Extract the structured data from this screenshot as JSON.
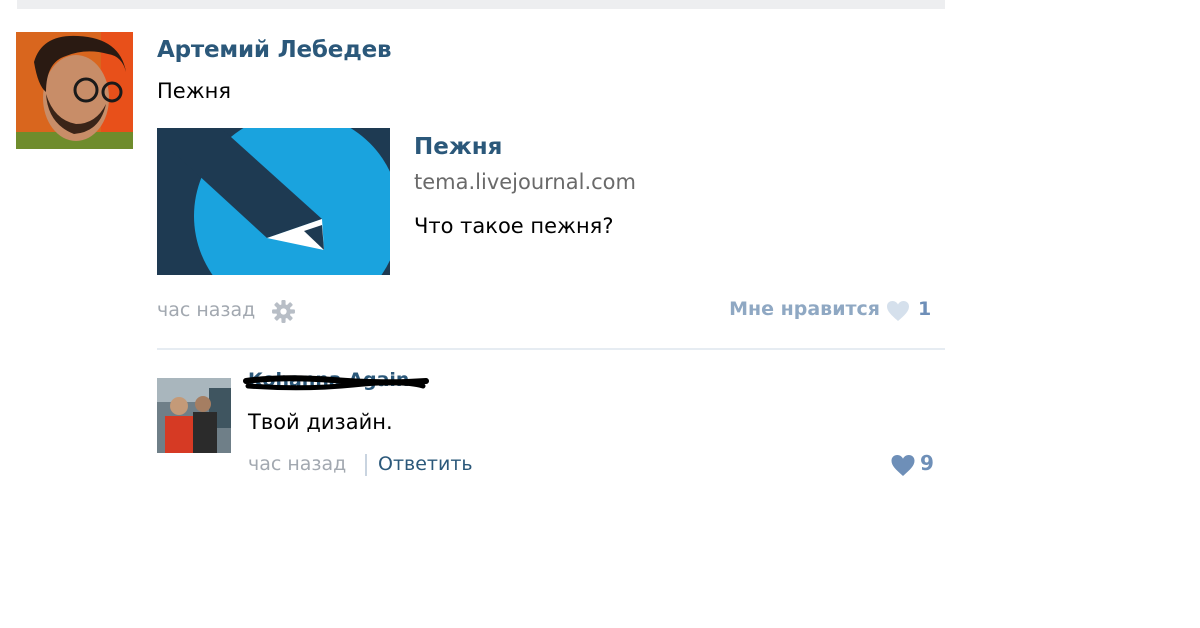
{
  "post": {
    "author": "Артемий Лебедев",
    "text": "Пежня",
    "link": {
      "title": "Пежня",
      "domain": "tema.livejournal.com",
      "description": "Что такое пежня?"
    },
    "time": "час назад",
    "like_label": "Мне нравится",
    "like_count": "1"
  },
  "comment": {
    "author": "Kohanna Again",
    "text": "Твой дизайн.",
    "time": "час назад",
    "reply_label": "Ответить",
    "like_count": "9"
  },
  "icons": {
    "settings": "gear-icon",
    "like": "heart-icon",
    "link_thumbnail": "pencil-icon"
  },
  "colors": {
    "link": "#2b587a",
    "meta": "#a2a8b0",
    "like": "#8fa8c3",
    "thumb_background": "#1e3a52",
    "thumb_circle": "#1aa3de"
  }
}
